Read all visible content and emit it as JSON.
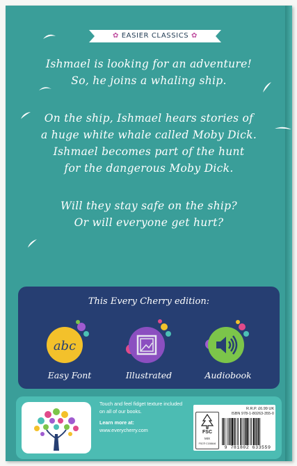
{
  "banner": {
    "label": "EASIER CLASSICS"
  },
  "blurb": {
    "p1_line1": "Ishmael is looking for an adventure!",
    "p1_line2": "So, he joins a whaling ship.",
    "p2_line1": "On the ship, Ishmael hears stories of",
    "p2_line2": "a huge white whale called Moby Dick.",
    "p2_line3": "Ishmael becomes part of the hunt",
    "p2_line4": "for the dangerous Moby Dick.",
    "p3_line1": "Will they stay safe on the ship?",
    "p3_line2": "Or will everyone get hurt?"
  },
  "features": {
    "title": "This Every Cherry edition:",
    "items": [
      {
        "label": "Easy Font",
        "icon": "abc-icon",
        "text": "abc"
      },
      {
        "label": "Illustrated",
        "icon": "picture-icon"
      },
      {
        "label": "Audiobook",
        "icon": "speaker-icon"
      }
    ]
  },
  "footer": {
    "fidget_text": "Touch and feel fidget texture included on all of our books.",
    "learn_more": "Learn more at:",
    "url": "www.everycherry.com",
    "price": "R.R.P. £6.99 UK",
    "isbn": "ISBN 978-1-80263-355-0",
    "barcode_number": "9 781802 633559",
    "fsc_mix": "MIX",
    "fsc_code": "FSC® C158446"
  },
  "colors": {
    "background": "#3a9e99",
    "panel": "#263e72",
    "footer": "#4cbcb3",
    "accent_yellow": "#f3c12b",
    "accent_purple": "#8b4fc0",
    "accent_green": "#7cc54a"
  }
}
